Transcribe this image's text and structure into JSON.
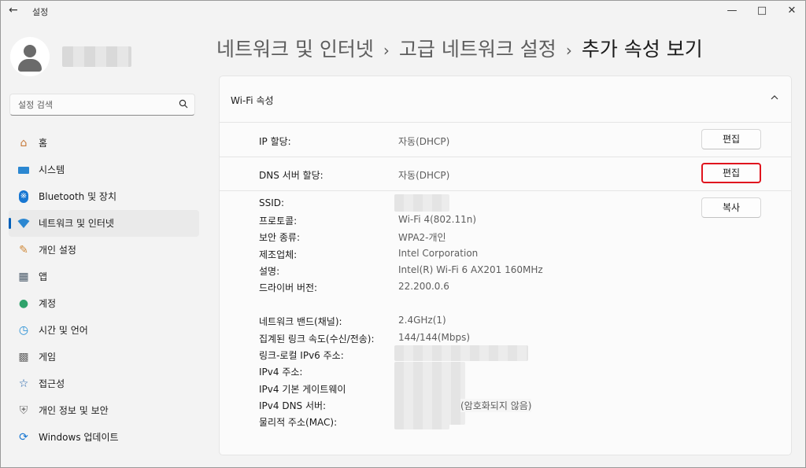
{
  "app": {
    "title": "설정"
  },
  "search": {
    "placeholder": "설정 검색"
  },
  "sidebar": {
    "items": [
      {
        "label": "홈",
        "icon": "home-icon"
      },
      {
        "label": "시스템",
        "icon": "monitor-icon"
      },
      {
        "label": "Bluetooth 및 장치",
        "icon": "bluetooth-icon"
      },
      {
        "label": "네트워크 및 인터넷",
        "icon": "wifi-icon",
        "active": true
      },
      {
        "label": "개인 설정",
        "icon": "brush-icon"
      },
      {
        "label": "앱",
        "icon": "apps-icon"
      },
      {
        "label": "계정",
        "icon": "person-icon"
      },
      {
        "label": "시간 및 언어",
        "icon": "globe-clock-icon"
      },
      {
        "label": "게임",
        "icon": "gamepad-icon"
      },
      {
        "label": "접근성",
        "icon": "accessibility-icon"
      },
      {
        "label": "개인 정보 및 보안",
        "icon": "shield-icon"
      },
      {
        "label": "Windows 업데이트",
        "icon": "update-icon"
      }
    ]
  },
  "breadcrumb": {
    "part1": "네트워크 및 인터넷",
    "part2": "고급 네트워크 설정",
    "current": "추가 속성 보기"
  },
  "card": {
    "title": "Wi-Fi 속성",
    "ip": {
      "label": "IP 할당:",
      "value": "자동(DHCP)",
      "button": "편집"
    },
    "dns": {
      "label": "DNS 서버 할당:",
      "value": "자동(DHCP)",
      "button": "편집"
    },
    "copy_button": "복사",
    "details": {
      "ssid": "SSID:",
      "protocol": {
        "label": "프로토콜:",
        "value": "Wi-Fi 4(802.11n)"
      },
      "security": {
        "label": "보안 종류:",
        "value": "WPA2-개인"
      },
      "manufacturer": {
        "label": "제조업체:",
        "value": "Intel Corporation"
      },
      "description": {
        "label": "설명:",
        "value": "Intel(R) Wi-Fi 6 AX201 160MHz"
      },
      "driver": {
        "label": "드라이버 버전:",
        "value": "22.200.0.6"
      },
      "band": {
        "label": "네트워크 밴드(채널):",
        "value": "2.4GHz(1)"
      },
      "speed": {
        "label": "집계된 링크 속도(수신/전송):",
        "value": "144/144(Mbps)"
      },
      "ipv6": "링크-로컬 IPv6 주소:",
      "ipv4": "IPv4 주소:",
      "gateway": "IPv4 기본 게이트웨이",
      "ipv4dns": {
        "label": "IPv4 DNS 서버:",
        "note": "(암호화되지 않음)"
      },
      "mac": "물리적 주소(MAC):"
    }
  },
  "colors": {
    "accent": "#005fb8",
    "highlight": "#e0141e"
  }
}
